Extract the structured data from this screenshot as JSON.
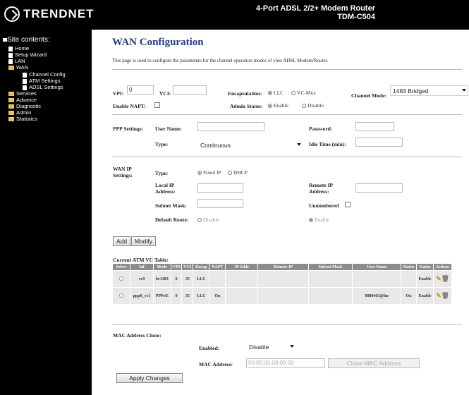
{
  "header": {
    "logo_text": "TRENDNET",
    "product_line": "4-Port ADSL 2/2+ Modem Router",
    "product_model": "TDM-C504"
  },
  "sidebar": {
    "title": "Site contents:",
    "items": [
      {
        "label": "Home",
        "icon": "page-icon"
      },
      {
        "label": "Setup Wizard",
        "icon": "page-icon"
      },
      {
        "label": "LAN",
        "icon": "page-icon"
      },
      {
        "label": "WAN",
        "icon": "folder-open-icon"
      },
      {
        "label": "Channel Config",
        "icon": "page-icon"
      },
      {
        "label": "ATM Settings",
        "icon": "page-icon"
      },
      {
        "label": "ADSL Settings",
        "icon": "page-icon"
      },
      {
        "label": "Services",
        "icon": "folder-icon"
      },
      {
        "label": "Advance",
        "icon": "folder-icon"
      },
      {
        "label": "Diagnostic",
        "icon": "folder-icon"
      },
      {
        "label": "Admin",
        "icon": "folder-icon"
      },
      {
        "label": "Statistics",
        "icon": "folder-icon"
      }
    ]
  },
  "page": {
    "title": "WAN Configuration",
    "description": "This page is used to configure the parameters for the channel operation modes of your ADSL Modem/Router."
  },
  "vc": {
    "vpi_label": "VPI:",
    "vpi_value": "0",
    "vci_label": "VCI:",
    "vci_value": "",
    "encapsulation_label": "Encapsulation:",
    "encap_llc": "LLC",
    "encap_vcmux": "VC-Mux",
    "channel_mode_label": "Channel Mode:",
    "channel_mode_value": "1483 Bridged",
    "napt_label": "Enable NAPT:",
    "admin_status_label": "Admin Status:",
    "admin_enable": "Enable",
    "admin_disable": "Disable"
  },
  "ppp": {
    "section_label": "PPP Settings:",
    "username_label": "User Name:",
    "password_label": "Password:",
    "type_label": "Type:",
    "type_value": "Continuous",
    "idle_label": "Idle Time (min):"
  },
  "wan_ip": {
    "section_label": "WAN IP Settings:",
    "type_label": "Type:",
    "fixed_ip": "Fixed IP",
    "dhcp": "DHCP",
    "local_ip_label": "Local IP Address:",
    "remote_ip_label": "Remote IP Address:",
    "subnet_label": "Subnet Mask:",
    "unnumbered_label": "Unnumbered",
    "default_route_label": "Default Route:",
    "route_disable": "Disable",
    "route_enable": "Enable"
  },
  "buttons": {
    "add": "Add",
    "modify": "Modify",
    "apply": "Apply Changes",
    "clone_mac": "Clone MAC Address"
  },
  "table": {
    "title": "Current ATM VC Table:",
    "headers": [
      "Select",
      "Inf",
      "Mode",
      "VPI",
      "VCI",
      "Encap",
      "NAPT",
      "IP Addr",
      "Remote IP",
      "Subnet Mask",
      "User Name",
      "Status",
      "Status",
      "Actions"
    ],
    "rows": [
      {
        "inf": "vc0",
        "mode": "br1483",
        "vpi": "0",
        "vci": "35",
        "encap": "LLC",
        "napt": "",
        "ip": "",
        "remote": "",
        "mask": "",
        "user": "",
        "dr": "",
        "status": "Enable"
      },
      {
        "inf": "ppp0_vc1",
        "mode": "PPPoE",
        "vpi": "0",
        "vci": "35",
        "encap": "LLC",
        "napt": "On",
        "ip": "",
        "remote": "",
        "mask": "",
        "user": "8800463@hn",
        "dr": "On",
        "status": "Enable"
      }
    ]
  },
  "mac": {
    "section_label": "MAC Address Clone:",
    "enabled_label": "Enabled:",
    "enabled_value": "Disable",
    "address_label": "MAC Address:",
    "address_value": "00:00:00:00:00:00"
  }
}
